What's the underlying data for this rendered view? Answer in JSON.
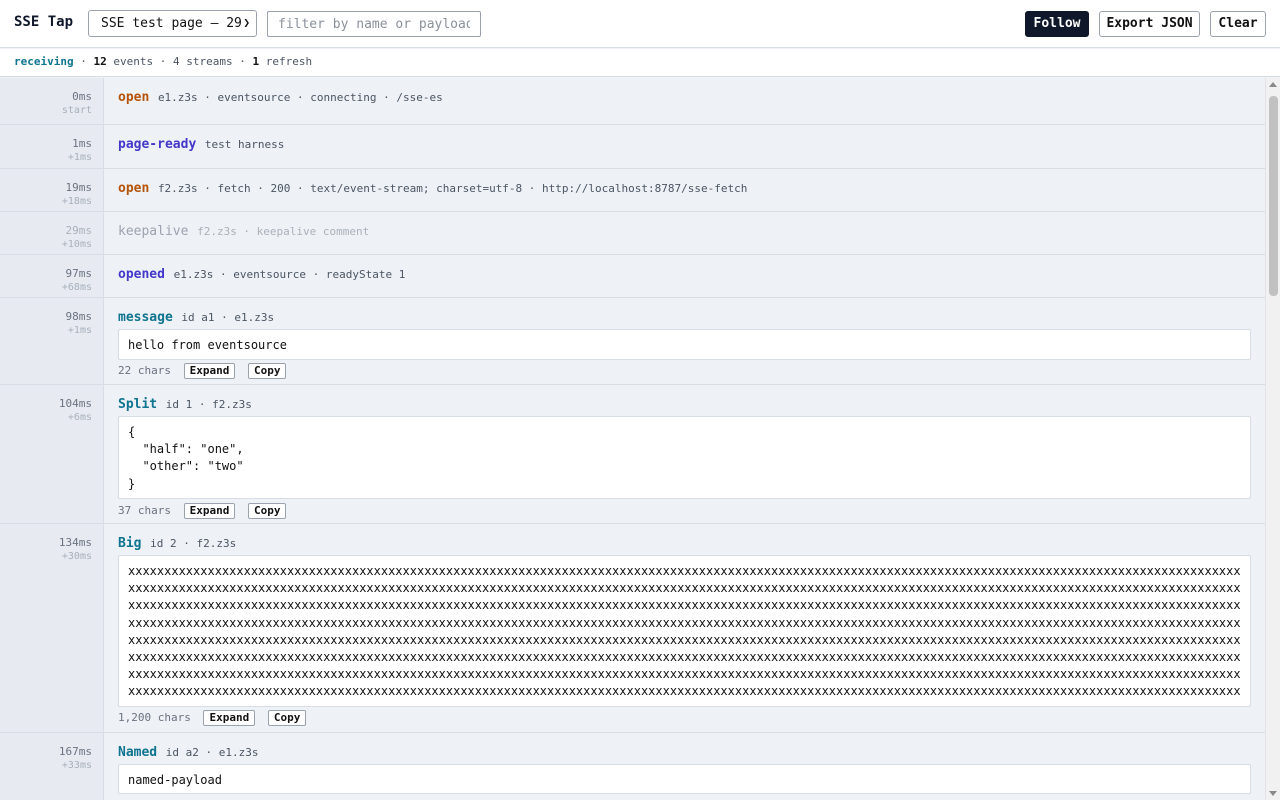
{
  "app": {
    "title": "SSE Tap"
  },
  "toolbar": {
    "stream_select": "SSE test page — 29",
    "filter_placeholder": "filter by name or payload",
    "follow": "Follow",
    "export": "Export JSON",
    "clear": "Clear"
  },
  "status": {
    "state": "receiving",
    "events_count": "12",
    "events_label": "events",
    "streams": "4 streams",
    "refresh_count": "1",
    "refresh_label": "refresh",
    "sep": "·"
  },
  "events": [
    {
      "time": "0ms",
      "delta": "start",
      "name": "open",
      "info": "e1.z3s · eventsource · connecting · /sse-es"
    },
    {
      "time": "1ms",
      "delta": "+1ms",
      "name": "page-ready",
      "info": "test harness"
    },
    {
      "time": "19ms",
      "delta": "+18ms",
      "name": "open",
      "info": "f2.z3s · fetch · 200 · text/event-stream; charset=utf-8 · http://localhost:8787/sse-fetch"
    },
    {
      "time": "29ms",
      "delta": "+10ms",
      "name": "keepalive",
      "info": "f2.z3s · keepalive comment"
    },
    {
      "time": "97ms",
      "delta": "+68ms",
      "name": "opened",
      "info": "e1.z3s · eventsource · readyState 1"
    },
    {
      "time": "98ms",
      "delta": "+1ms",
      "name": "message",
      "info": "id a1 · e1.z3s",
      "payload": "hello from eventsource",
      "chars": "22 chars"
    },
    {
      "time": "104ms",
      "delta": "+6ms",
      "name": "Split",
      "info": "id 1 · f2.z3s",
      "payload": "{\n  \"half\": \"one\",\n  \"other\": \"two\"\n}",
      "chars": "37 chars"
    },
    {
      "time": "134ms",
      "delta": "+30ms",
      "name": "Big",
      "info": "id 2 · f2.z3s",
      "payload": "xxxxxxxxxxxxxxxxxxxxxxxxxxxxxxxxxxxxxxxxxxxxxxxxxxxxxxxxxxxxxxxxxxxxxxxxxxxxxxxxxxxxxxxxxxxxxxxxxxxxxxxxxxxxxxxxxxxxxxxxxxxxxxxxxxxxxxxxxxxxxxxxxxxxxxxxxxxxxxxxxxxxxxxxxxxxxxxxxxxxxxxxxxxxxxxxxxxxxxxxxxxxxxxxxxxxxxxxxxxxxxxxxxxxxxxxxxxxxxxxxxxxxxxxxxxxxxxxxxxxxxxxxxxxxxxxxxxxxxxxxxxxxxxxxxxxxxxxxxxxxxxxxxxxxxxxxxxxxxxxxxxxxxxxxxxxxxxxxxxxxxxxxxxxxxxxxxxxxxxxxxxxxxxxxxxxxxxxxxxxxxxxxxxxxxxxxxxxxxxxxxxxxxxxxxxxxxxxxxxxxxxxxxxxxxxxxxxxxxxxxxxxxxxxxxxxxxxxxxxxxxxxxxxxxxxxxxxxxxxxxxxxxxxxxxxxxxxxxxxxxxxxxxxxxxxxxxxxxxxxxxxxxxxxxxxxxxxxxxxxxxxxxxxxxxxxxxxxxxxxxxxxxxxxxxxxxxxxxxxxxxxxxxxxxxxxxxxxxxxxxxxxxxxxxxxxxxxxxxxxxxxxxxxxxxxxxxxxxxxxxxxxxxxxxxxxxxxxxxxxxxxxxxxxxxxxxxxxxxxxxxxxxxxxxxxxxxxxxxxxxxxxxxxxxxxxxxxxxxxxxxxxxxxxxxxxxxxxxxxxxxxxxxxxxxxxxxxxxxxxxxxxxxxxxxxxxxxxxxxxxxxxxxxxxxxxxxxxxxxxxxxxxxxxxxxxxxxxxxxxxxxxxxxxxxxxxxxxxxxxxxxxxxxxxxxxxxxxxxxxxxxxxxxxxxxxxxxxxxxxxxxxxxxxxxxxxxxxxxxxxxxxxxxxxxxxxxxxxxxxxxxxxxxxxxxxxxxxxxxxxxxxxxxxxxxxxxxxxxxxxxxxxxxxxxxxxxxxxxxxxxxxxxxxxxxxxxxxxxxxxxxxxxxxxxxxxxxxxxxxxxxxxxxxxxxxxxxxxxxxxxxxxxxxxxxxxxxxxxxxxxxxxxxxxxxxxxxxxxxxxxxxxxxxxxxxxxxxxxxxxxxxxxxxxxxxxxxxxxxxxxxxxxxxxxxxxxxxxxxxxxxxxxxxxxxxxxxxxxxxxxxxxxxxxxxxxxxxxxxxxxxxxxxxxxxxxxxxxxxxxxxxxxxxxxxxxxxxxxxxxxxxxxxxxxxxxxxxxxxxxxxxxxxxxxxxxxxxxxxxxxxxxxxxxxxxxxxxxxxxxxxxxxxxxxxxxxxxxxxxxxxxxxxxxxxxxxxxxxxxxxxxxxxxxxxxxxxxxxxxxxxxxxxxxxxxxxxxxxxxxxxxxxxxxxxxxxxxxxxxxxxxxxxxxxxxxxxxxxxxxxxxxxxxxxxxxxxxxxxxxxxxxxxxxxxxxxxxxxxxxxxxxxxxxxxxxxxxxxxxxxxxxxxxxxxxxxxxxxxxxxxxxxxxxxxxxxxxxxxxxxxxxxxxxxxxxxxxxxxxxxxxxxxxxxxxxxxxxxxxxxxxxxxxxxxxxxxxxxxxxxxxxxxxxxxxxxxxxxxxxxxxxxxxxxxxxxxxxxxxxxxxxxxxxxxxxxxxxxxxxxxxxxxxxxxxxxxxxxx",
      "chars": "1,200 chars"
    },
    {
      "time": "167ms",
      "delta": "+33ms",
      "name": "Named",
      "info": "id a2 · e1.z3s",
      "payload": "named-payload"
    }
  ],
  "actions": {
    "expand": "Expand",
    "copy": "Copy"
  }
}
